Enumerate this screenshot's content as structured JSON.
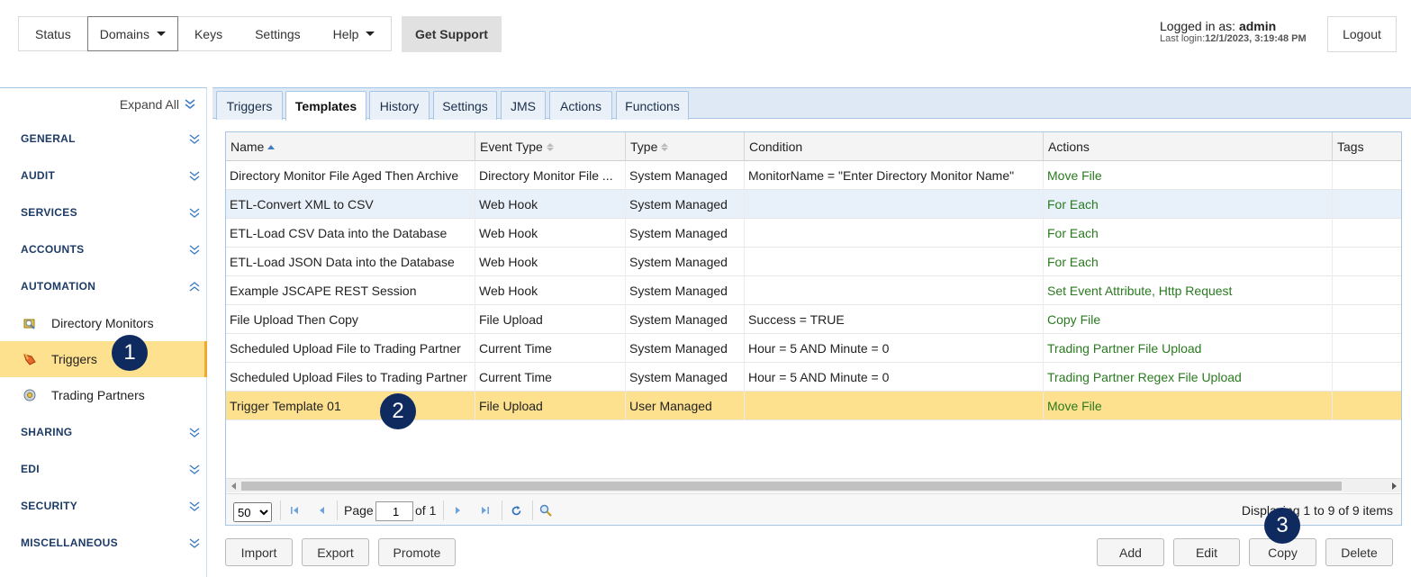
{
  "topnav": {
    "items": [
      {
        "label": "Status"
      },
      {
        "label": "Domains"
      },
      {
        "label": "Keys"
      },
      {
        "label": "Settings"
      },
      {
        "label": "Help"
      }
    ],
    "support_label": "Get Support"
  },
  "login": {
    "prefix": "Logged in as: ",
    "user": "admin",
    "last_prefix": "Last login:",
    "last_value": "12/1/2023, 3:19:48 PM",
    "logout_label": "Logout"
  },
  "sidebar": {
    "expand_all": "Expand All",
    "sections": [
      {
        "label": "GENERAL"
      },
      {
        "label": "AUDIT"
      },
      {
        "label": "SERVICES"
      },
      {
        "label": "ACCOUNTS"
      },
      {
        "label": "AUTOMATION"
      },
      {
        "label": "SHARING"
      },
      {
        "label": "EDI"
      },
      {
        "label": "SECURITY"
      },
      {
        "label": "MISCELLANEOUS"
      }
    ],
    "automation_items": [
      {
        "label": "Directory Monitors",
        "icon": "directory-monitor-icon"
      },
      {
        "label": "Triggers",
        "icon": "trigger-icon"
      },
      {
        "label": "Trading Partners",
        "icon": "trading-partner-icon"
      }
    ]
  },
  "badges": [
    "1",
    "2",
    "3"
  ],
  "tabs": [
    {
      "label": "Triggers"
    },
    {
      "label": "Templates"
    },
    {
      "label": "History"
    },
    {
      "label": "Settings"
    },
    {
      "label": "JMS"
    },
    {
      "label": "Actions"
    },
    {
      "label": "Functions"
    }
  ],
  "grid": {
    "columns": [
      "Name",
      "Event Type",
      "Type",
      "Condition",
      "Actions",
      "Tags"
    ],
    "rows": [
      {
        "name": "Directory Monitor File Aged Then Archive",
        "event": "Directory Monitor File ...",
        "type": "System Managed",
        "condition": "MonitorName = \"Enter Directory Monitor Name\"",
        "actions": "Move File",
        "tags": ""
      },
      {
        "name": "ETL-Convert XML to CSV",
        "event": "Web Hook",
        "type": "System Managed",
        "condition": "",
        "actions": "For Each",
        "tags": ""
      },
      {
        "name": "ETL-Load CSV Data into the Database",
        "event": "Web Hook",
        "type": "System Managed",
        "condition": "",
        "actions": "For Each",
        "tags": ""
      },
      {
        "name": "ETL-Load JSON Data into the Database",
        "event": "Web Hook",
        "type": "System Managed",
        "condition": "",
        "actions": "For Each",
        "tags": ""
      },
      {
        "name": "Example JSCAPE REST Session",
        "event": "Web Hook",
        "type": "System Managed",
        "condition": "",
        "actions": "Set Event Attribute, Http Request",
        "tags": ""
      },
      {
        "name": "File Upload Then Copy",
        "event": "File Upload",
        "type": "System Managed",
        "condition": "Success = TRUE",
        "actions": "Copy File",
        "tags": ""
      },
      {
        "name": "Scheduled Upload File to Trading Partner",
        "event": "Current Time",
        "type": "System Managed",
        "condition": "Hour = 5 AND Minute = 0",
        "actions": "Trading Partner File Upload",
        "tags": ""
      },
      {
        "name": "Scheduled Upload Files to Trading Partner",
        "event": "Current Time",
        "type": "System Managed",
        "condition": "Hour = 5 AND Minute = 0",
        "actions": "Trading Partner Regex File Upload",
        "tags": ""
      },
      {
        "name": "Trigger Template 01",
        "event": "File Upload",
        "type": "User Managed",
        "condition": "",
        "actions": "Move File",
        "tags": ""
      }
    ]
  },
  "pager": {
    "page_size": "50",
    "page_label": "Page",
    "page_value": "1",
    "of_label": "of 1",
    "display_text": "Displaying 1 to 9 of 9 items"
  },
  "buttons": {
    "import": "Import",
    "export": "Export",
    "promote": "Promote",
    "add": "Add",
    "edit": "Edit",
    "copy": "Copy",
    "delete": "Delete"
  },
  "colors": {
    "selected_row": "#fde18e",
    "hover_row": "#e8f0fa",
    "action_link": "#2a7a1f",
    "badge": "#0e2a5e",
    "section_label": "#1d3b66"
  }
}
